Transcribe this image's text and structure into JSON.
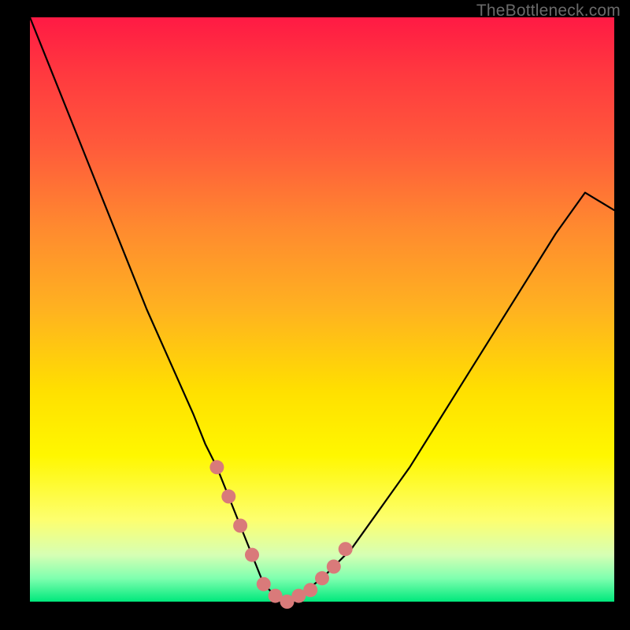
{
  "watermark": "TheBottleneck.com",
  "colors": {
    "background": "#000000",
    "gradient_top": "#ff1a44",
    "gradient_mid": "#ffe000",
    "gradient_bottom": "#00e87c",
    "curve_stroke": "#000000",
    "marker_fill": "#d97a7a"
  },
  "chart_data": {
    "type": "line",
    "title": "",
    "xlabel": "",
    "ylabel": "",
    "xlim": [
      0,
      100
    ],
    "ylim": [
      0,
      100
    ],
    "series": [
      {
        "name": "bottleneck-curve",
        "x": [
          0,
          4,
          8,
          12,
          16,
          20,
          24,
          28,
          30,
          32,
          34,
          36,
          38,
          40,
          42,
          44,
          46,
          50,
          55,
          60,
          65,
          70,
          75,
          80,
          85,
          90,
          95,
          100
        ],
        "y": [
          100,
          90,
          80,
          70,
          60,
          50,
          41,
          32,
          27,
          23,
          18,
          13,
          8,
          3,
          1,
          0,
          1,
          4,
          9,
          16,
          23,
          31,
          39,
          47,
          55,
          63,
          70,
          67
        ]
      }
    ],
    "markers": {
      "name": "highlight-dots",
      "x": [
        32,
        34,
        36,
        38,
        40,
        42,
        44,
        46,
        48,
        50,
        52,
        54
      ],
      "y": [
        23,
        18,
        13,
        8,
        3,
        1,
        0,
        1,
        2,
        4,
        6,
        9
      ]
    }
  }
}
